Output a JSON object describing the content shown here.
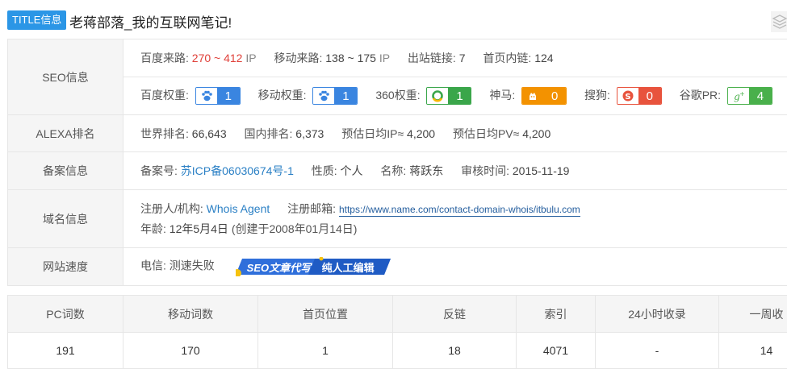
{
  "header": {
    "badge": "TITLE信息",
    "title": "老蒋部落_我的互联网笔记!"
  },
  "seo": {
    "label": "SEO信息",
    "row1": [
      {
        "key": "百度来路:",
        "value": "270 ~ 412",
        "unit": "IP"
      },
      {
        "key": "移动来路:",
        "value": "138 ~ 175",
        "unit": "IP"
      },
      {
        "key": "出站链接:",
        "value": "7"
      },
      {
        "key": "首页内链:",
        "value": "124"
      }
    ],
    "ranks": [
      {
        "key": "百度权重:",
        "value": "1",
        "icon": "baidu-paw-icon"
      },
      {
        "key": "移动权重:",
        "value": "1",
        "icon": "baidu-mobile-paw-icon"
      },
      {
        "key": "360权重:",
        "value": "1",
        "icon": "360-ring-icon"
      },
      {
        "key": "神马:",
        "value": "0",
        "icon": "shenma-horse-icon"
      },
      {
        "key": "搜狗:",
        "value": "0",
        "icon": "sogou-s-icon"
      },
      {
        "key": "谷歌PR:",
        "value": "4",
        "icon": "google-plus-icon"
      }
    ]
  },
  "alexa": {
    "label": "ALEXA排名",
    "items": [
      {
        "key": "世界排名:",
        "value": "66,643"
      },
      {
        "key": "国内排名:",
        "value": "6,373"
      },
      {
        "key": "预估日均IP≈",
        "value": "4,200"
      },
      {
        "key": "预估日均PV≈",
        "value": "4,200"
      }
    ]
  },
  "beian": {
    "label": "备案信息",
    "number_key": "备案号:",
    "number": "苏ICP备06030674号-1",
    "nature_key": "性质:",
    "nature": "个人",
    "name_key": "名称:",
    "name": "蒋跃东",
    "audit_key": "审核时间:",
    "audit": "2015-11-19"
  },
  "domain": {
    "label": "域名信息",
    "registrant_key": "注册人/机构:",
    "registrant": "Whois Agent",
    "email_key": "注册邮箱:",
    "email": "https://www.name.com/contact-domain-whois/itbulu.com",
    "age_key": "年龄:",
    "age": "12年5月4日",
    "created": "(创建于2008年01月14日)"
  },
  "speed": {
    "label": "网站速度",
    "telecom": "电信: 测速失败",
    "banner_left": "SEO文章代写",
    "banner_right": "纯人工编辑"
  },
  "stats": {
    "headers": [
      "PC词数",
      "移动词数",
      "首页位置",
      "反链",
      "索引",
      "24小时收录",
      "一周收"
    ],
    "values": [
      "191",
      "170",
      "1",
      "18",
      "4071",
      "-",
      "14"
    ]
  },
  "colors": {
    "accent": "#2b96e6",
    "red": "#e0413a",
    "baidu_blue": "#3a85e0",
    "green": "#3aa64a",
    "orange": "#f39200",
    "sogou_red": "#e8533d"
  }
}
